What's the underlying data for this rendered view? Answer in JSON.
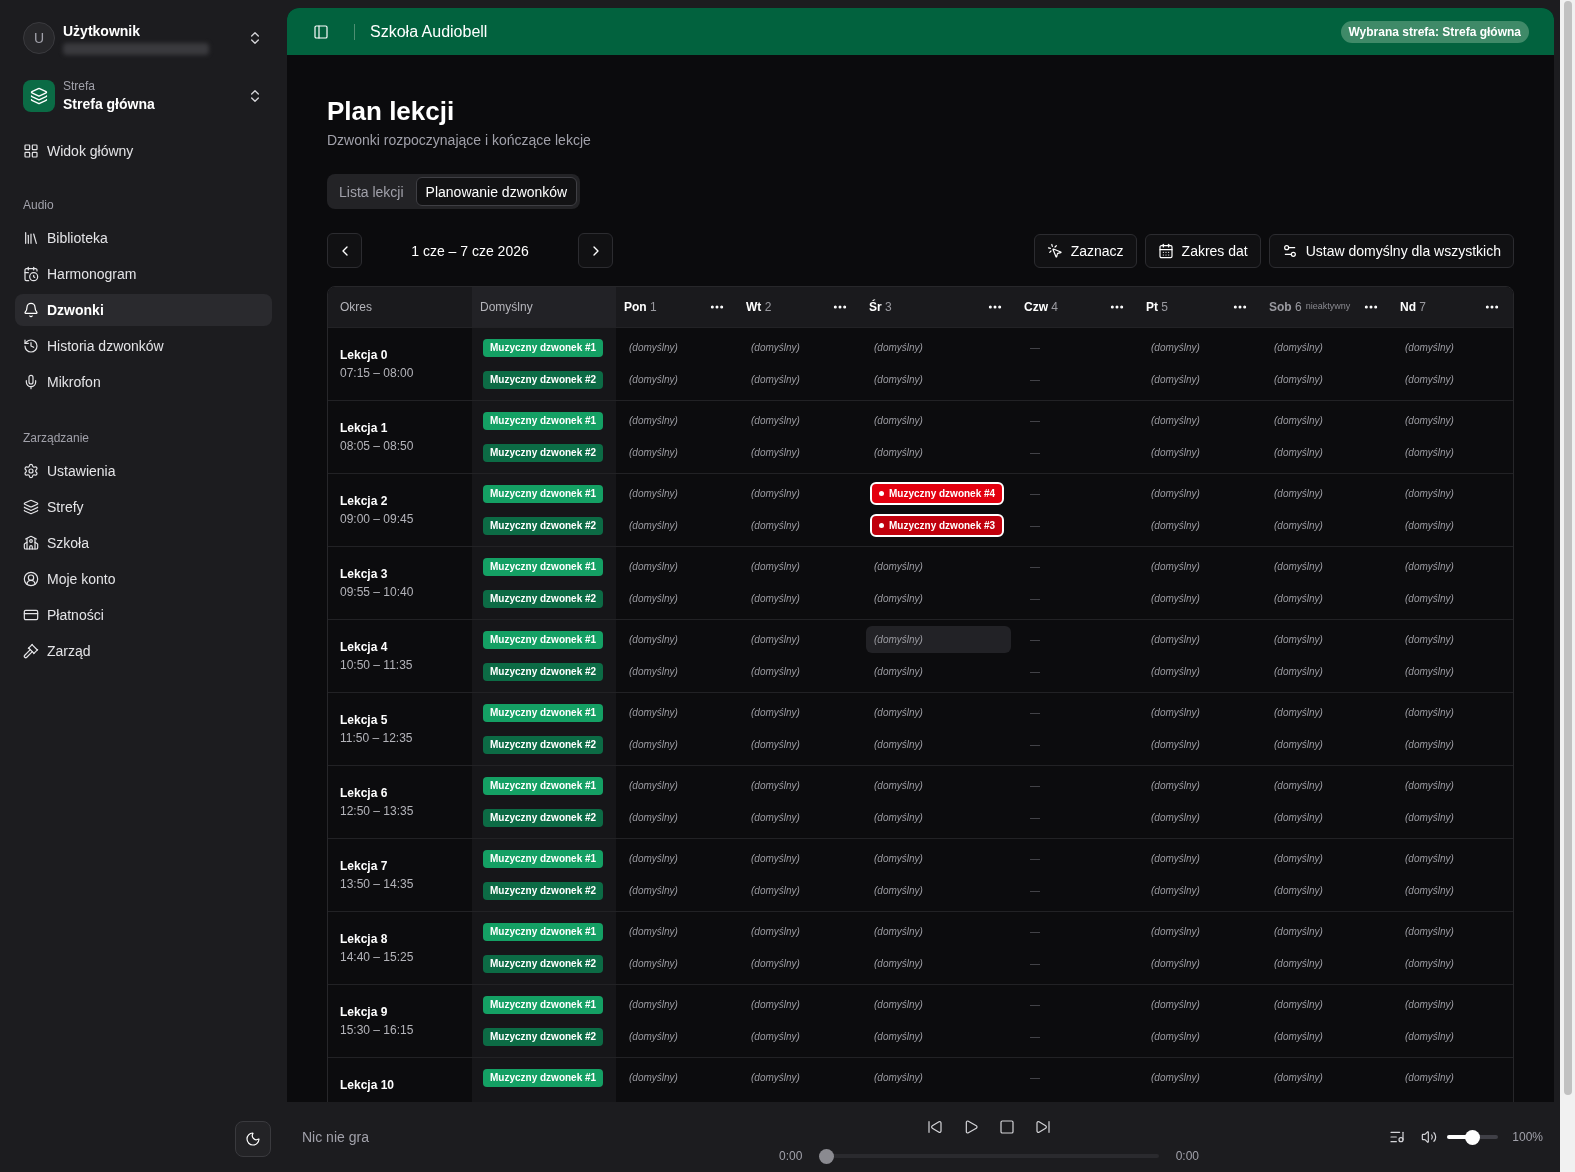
{
  "sidebar": {
    "user": {
      "avatar_letter": "U",
      "name": "Użytkownik"
    },
    "zone": {
      "label": "Strefa",
      "name": "Strefa główna"
    },
    "top_items": [
      {
        "label": "Widok główny",
        "selected": false
      }
    ],
    "sections": [
      {
        "title": "Audio",
        "items": [
          {
            "label": "Biblioteka",
            "selected": false
          },
          {
            "label": "Harmonogram",
            "selected": false
          },
          {
            "label": "Dzwonki",
            "selected": true
          },
          {
            "label": "Historia dzwonków",
            "selected": false
          },
          {
            "label": "Mikrofon",
            "selected": false
          }
        ]
      },
      {
        "title": "Zarządzanie",
        "items": [
          {
            "label": "Ustawienia",
            "selected": false
          },
          {
            "label": "Strefy",
            "selected": false
          },
          {
            "label": "Szkoła",
            "selected": false
          },
          {
            "label": "Moje konto",
            "selected": false
          },
          {
            "label": "Płatności",
            "selected": false
          },
          {
            "label": "Zarząd",
            "selected": false
          }
        ]
      }
    ]
  },
  "header": {
    "title": "Szkoła Audiobell",
    "zone_badge": "Wybrana strefa: Strefa główna"
  },
  "page": {
    "title": "Plan lekcji",
    "subtitle": "Dzwonki rozpoczynające i kończące lekcje"
  },
  "tabs": [
    {
      "label": "Lista lekcji",
      "selected": false
    },
    {
      "label": "Planowanie dzwonków",
      "selected": true
    }
  ],
  "date_range": "1 cze – 7 cze 2026",
  "actions": [
    {
      "label": "Zaznacz"
    },
    {
      "label": "Zakres dat"
    },
    {
      "label": "Ustaw domyślny dla wszystkich"
    }
  ],
  "table": {
    "columns": {
      "period": "Okres",
      "default": "Domyślny"
    },
    "days": [
      {
        "name": "Pon",
        "number": "1",
        "active": true
      },
      {
        "name": "Wt",
        "number": "2",
        "active": true
      },
      {
        "name": "Śr",
        "number": "3",
        "active": true
      },
      {
        "name": "Czw",
        "number": "4",
        "active": true
      },
      {
        "name": "Pt",
        "number": "5",
        "active": true
      },
      {
        "name": "Sob",
        "number": "6",
        "active": false,
        "note": "nieaktywny"
      },
      {
        "name": "Nd",
        "number": "7",
        "active": true
      }
    ],
    "rows": [
      {
        "name": "Lekcja 0",
        "time": "07:15 – 08:00",
        "slots": [
          {
            "default": {
              "label": "Muzyczny dzwonek #1",
              "color": "#14a064"
            },
            "cells": [
              {
                "kind": "default",
                "text": "(domyślny)",
                "highlighted": false
              },
              {
                "kind": "default",
                "text": "(domyślny)",
                "highlighted": false
              },
              {
                "kind": "default",
                "text": "(domyślny)",
                "highlighted": false
              },
              {
                "kind": "empty",
                "text": "—",
                "highlighted": false
              },
              {
                "kind": "default",
                "text": "(domyślny)",
                "highlighted": false
              },
              {
                "kind": "default",
                "text": "(domyślny)",
                "highlighted": false
              },
              {
                "kind": "default",
                "text": "(domyślny)",
                "highlighted": false
              }
            ]
          },
          {
            "default": {
              "label": "Muzyczny dzwonek #2",
              "color": "#0c6b45"
            },
            "cells": [
              {
                "kind": "default",
                "text": "(domyślny)",
                "highlighted": false
              },
              {
                "kind": "default",
                "text": "(domyślny)",
                "highlighted": false
              },
              {
                "kind": "default",
                "text": "(domyślny)",
                "highlighted": false
              },
              {
                "kind": "empty",
                "text": "—",
                "highlighted": false
              },
              {
                "kind": "default",
                "text": "(domyślny)",
                "highlighted": false
              },
              {
                "kind": "default",
                "text": "(domyślny)",
                "highlighted": false
              },
              {
                "kind": "default",
                "text": "(domyślny)",
                "highlighted": false
              }
            ]
          }
        ]
      },
      {
        "name": "Lekcja 1",
        "time": "08:05 – 08:50",
        "slots": [
          {
            "default": {
              "label": "Muzyczny dzwonek #1",
              "color": "#14a064"
            },
            "cells": [
              {
                "kind": "default",
                "text": "(domyślny)",
                "highlighted": false
              },
              {
                "kind": "default",
                "text": "(domyślny)",
                "highlighted": false
              },
              {
                "kind": "default",
                "text": "(domyślny)",
                "highlighted": false
              },
              {
                "kind": "empty",
                "text": "—",
                "highlighted": false
              },
              {
                "kind": "default",
                "text": "(domyślny)",
                "highlighted": false
              },
              {
                "kind": "default",
                "text": "(domyślny)",
                "highlighted": false
              },
              {
                "kind": "default",
                "text": "(domyślny)",
                "highlighted": false
              }
            ]
          },
          {
            "default": {
              "label": "Muzyczny dzwonek #2",
              "color": "#0c6b45"
            },
            "cells": [
              {
                "kind": "default",
                "text": "(domyślny)",
                "highlighted": false
              },
              {
                "kind": "default",
                "text": "(domyślny)",
                "highlighted": false
              },
              {
                "kind": "default",
                "text": "(domyślny)",
                "highlighted": false
              },
              {
                "kind": "empty",
                "text": "—",
                "highlighted": false
              },
              {
                "kind": "default",
                "text": "(domyślny)",
                "highlighted": false
              },
              {
                "kind": "default",
                "text": "(domyślny)",
                "highlighted": false
              },
              {
                "kind": "default",
                "text": "(domyślny)",
                "highlighted": false
              }
            ]
          }
        ]
      },
      {
        "name": "Lekcja 2",
        "time": "09:00 – 09:45",
        "slots": [
          {
            "default": {
              "label": "Muzyczny dzwonek #1",
              "color": "#14a064"
            },
            "cells": [
              {
                "kind": "default",
                "text": "(domyślny)",
                "highlighted": false
              },
              {
                "kind": "default",
                "text": "(domyślny)",
                "highlighted": false
              },
              {
                "kind": "override",
                "text": "Muzyczny dzwonek #4",
                "color": "#e3000f",
                "highlighted": false
              },
              {
                "kind": "empty",
                "text": "—",
                "highlighted": false
              },
              {
                "kind": "default",
                "text": "(domyślny)",
                "highlighted": false
              },
              {
                "kind": "default",
                "text": "(domyślny)",
                "highlighted": false
              },
              {
                "kind": "default",
                "text": "(domyślny)",
                "highlighted": false
              }
            ]
          },
          {
            "default": {
              "label": "Muzyczny dzwonek #2",
              "color": "#0c6b45"
            },
            "cells": [
              {
                "kind": "default",
                "text": "(domyślny)",
                "highlighted": false
              },
              {
                "kind": "default",
                "text": "(domyślny)",
                "highlighted": false
              },
              {
                "kind": "override",
                "text": "Muzyczny dzwonek #3",
                "color": "#c0000c",
                "highlighted": false
              },
              {
                "kind": "empty",
                "text": "—",
                "highlighted": false
              },
              {
                "kind": "default",
                "text": "(domyślny)",
                "highlighted": false
              },
              {
                "kind": "default",
                "text": "(domyślny)",
                "highlighted": false
              },
              {
                "kind": "default",
                "text": "(domyślny)",
                "highlighted": false
              }
            ]
          }
        ]
      },
      {
        "name": "Lekcja 3",
        "time": "09:55 – 10:40",
        "slots": [
          {
            "default": {
              "label": "Muzyczny dzwonek #1",
              "color": "#14a064"
            },
            "cells": [
              {
                "kind": "default",
                "text": "(domyślny)",
                "highlighted": false
              },
              {
                "kind": "default",
                "text": "(domyślny)",
                "highlighted": false
              },
              {
                "kind": "default",
                "text": "(domyślny)",
                "highlighted": false
              },
              {
                "kind": "empty",
                "text": "—",
                "highlighted": false
              },
              {
                "kind": "default",
                "text": "(domyślny)",
                "highlighted": false
              },
              {
                "kind": "default",
                "text": "(domyślny)",
                "highlighted": false
              },
              {
                "kind": "default",
                "text": "(domyślny)",
                "highlighted": false
              }
            ]
          },
          {
            "default": {
              "label": "Muzyczny dzwonek #2",
              "color": "#0c6b45"
            },
            "cells": [
              {
                "kind": "default",
                "text": "(domyślny)",
                "highlighted": false
              },
              {
                "kind": "default",
                "text": "(domyślny)",
                "highlighted": false
              },
              {
                "kind": "default",
                "text": "(domyślny)",
                "highlighted": false
              },
              {
                "kind": "empty",
                "text": "—",
                "highlighted": false
              },
              {
                "kind": "default",
                "text": "(domyślny)",
                "highlighted": false
              },
              {
                "kind": "default",
                "text": "(domyślny)",
                "highlighted": false
              },
              {
                "kind": "default",
                "text": "(domyślny)",
                "highlighted": false
              }
            ]
          }
        ]
      },
      {
        "name": "Lekcja 4",
        "time": "10:50 – 11:35",
        "slots": [
          {
            "default": {
              "label": "Muzyczny dzwonek #1",
              "color": "#14a064"
            },
            "cells": [
              {
                "kind": "default",
                "text": "(domyślny)",
                "highlighted": false
              },
              {
                "kind": "default",
                "text": "(domyślny)",
                "highlighted": false
              },
              {
                "kind": "default",
                "text": "(domyślny)",
                "highlighted": true
              },
              {
                "kind": "empty",
                "text": "—",
                "highlighted": false
              },
              {
                "kind": "default",
                "text": "(domyślny)",
                "highlighted": false
              },
              {
                "kind": "default",
                "text": "(domyślny)",
                "highlighted": false
              },
              {
                "kind": "default",
                "text": "(domyślny)",
                "highlighted": false
              }
            ]
          },
          {
            "default": {
              "label": "Muzyczny dzwonek #2",
              "color": "#0c6b45"
            },
            "cells": [
              {
                "kind": "default",
                "text": "(domyślny)",
                "highlighted": false
              },
              {
                "kind": "default",
                "text": "(domyślny)",
                "highlighted": false
              },
              {
                "kind": "default",
                "text": "(domyślny)",
                "highlighted": false
              },
              {
                "kind": "empty",
                "text": "—",
                "highlighted": false
              },
              {
                "kind": "default",
                "text": "(domyślny)",
                "highlighted": false
              },
              {
                "kind": "default",
                "text": "(domyślny)",
                "highlighted": false
              },
              {
                "kind": "default",
                "text": "(domyślny)",
                "highlighted": false
              }
            ]
          }
        ]
      },
      {
        "name": "Lekcja 5",
        "time": "11:50 – 12:35",
        "slots": [
          {
            "default": {
              "label": "Muzyczny dzwonek #1",
              "color": "#14a064"
            },
            "cells": [
              {
                "kind": "default",
                "text": "(domyślny)",
                "highlighted": false
              },
              {
                "kind": "default",
                "text": "(domyślny)",
                "highlighted": false
              },
              {
                "kind": "default",
                "text": "(domyślny)",
                "highlighted": false
              },
              {
                "kind": "empty",
                "text": "—",
                "highlighted": false
              },
              {
                "kind": "default",
                "text": "(domyślny)",
                "highlighted": false
              },
              {
                "kind": "default",
                "text": "(domyślny)",
                "highlighted": false
              },
              {
                "kind": "default",
                "text": "(domyślny)",
                "highlighted": false
              }
            ]
          },
          {
            "default": {
              "label": "Muzyczny dzwonek #2",
              "color": "#0c6b45"
            },
            "cells": [
              {
                "kind": "default",
                "text": "(domyślny)",
                "highlighted": false
              },
              {
                "kind": "default",
                "text": "(domyślny)",
                "highlighted": false
              },
              {
                "kind": "default",
                "text": "(domyślny)",
                "highlighted": false
              },
              {
                "kind": "empty",
                "text": "—",
                "highlighted": false
              },
              {
                "kind": "default",
                "text": "(domyślny)",
                "highlighted": false
              },
              {
                "kind": "default",
                "text": "(domyślny)",
                "highlighted": false
              },
              {
                "kind": "default",
                "text": "(domyślny)",
                "highlighted": false
              }
            ]
          }
        ]
      },
      {
        "name": "Lekcja 6",
        "time": "12:50 – 13:35",
        "slots": [
          {
            "default": {
              "label": "Muzyczny dzwonek #1",
              "color": "#14a064"
            },
            "cells": [
              {
                "kind": "default",
                "text": "(domyślny)",
                "highlighted": false
              },
              {
                "kind": "default",
                "text": "(domyślny)",
                "highlighted": false
              },
              {
                "kind": "default",
                "text": "(domyślny)",
                "highlighted": false
              },
              {
                "kind": "empty",
                "text": "—",
                "highlighted": false
              },
              {
                "kind": "default",
                "text": "(domyślny)",
                "highlighted": false
              },
              {
                "kind": "default",
                "text": "(domyślny)",
                "highlighted": false
              },
              {
                "kind": "default",
                "text": "(domyślny)",
                "highlighted": false
              }
            ]
          },
          {
            "default": {
              "label": "Muzyczny dzwonek #2",
              "color": "#0c6b45"
            },
            "cells": [
              {
                "kind": "default",
                "text": "(domyślny)",
                "highlighted": false
              },
              {
                "kind": "default",
                "text": "(domyślny)",
                "highlighted": false
              },
              {
                "kind": "default",
                "text": "(domyślny)",
                "highlighted": false
              },
              {
                "kind": "empty",
                "text": "—",
                "highlighted": false
              },
              {
                "kind": "default",
                "text": "(domyślny)",
                "highlighted": false
              },
              {
                "kind": "default",
                "text": "(domyślny)",
                "highlighted": false
              },
              {
                "kind": "default",
                "text": "(domyślny)",
                "highlighted": false
              }
            ]
          }
        ]
      },
      {
        "name": "Lekcja 7",
        "time": "13:50 – 14:35",
        "slots": [
          {
            "default": {
              "label": "Muzyczny dzwonek #1",
              "color": "#14a064"
            },
            "cells": [
              {
                "kind": "default",
                "text": "(domyślny)",
                "highlighted": false
              },
              {
                "kind": "default",
                "text": "(domyślny)",
                "highlighted": false
              },
              {
                "kind": "default",
                "text": "(domyślny)",
                "highlighted": false
              },
              {
                "kind": "empty",
                "text": "—",
                "highlighted": false
              },
              {
                "kind": "default",
                "text": "(domyślny)",
                "highlighted": false
              },
              {
                "kind": "default",
                "text": "(domyślny)",
                "highlighted": false
              },
              {
                "kind": "default",
                "text": "(domyślny)",
                "highlighted": false
              }
            ]
          },
          {
            "default": {
              "label": "Muzyczny dzwonek #2",
              "color": "#0c6b45"
            },
            "cells": [
              {
                "kind": "default",
                "text": "(domyślny)",
                "highlighted": false
              },
              {
                "kind": "default",
                "text": "(domyślny)",
                "highlighted": false
              },
              {
                "kind": "default",
                "text": "(domyślny)",
                "highlighted": false
              },
              {
                "kind": "empty",
                "text": "—",
                "highlighted": false
              },
              {
                "kind": "default",
                "text": "(domyślny)",
                "highlighted": false
              },
              {
                "kind": "default",
                "text": "(domyślny)",
                "highlighted": false
              },
              {
                "kind": "default",
                "text": "(domyślny)",
                "highlighted": false
              }
            ]
          }
        ]
      },
      {
        "name": "Lekcja 8",
        "time": "14:40 – 15:25",
        "slots": [
          {
            "default": {
              "label": "Muzyczny dzwonek #1",
              "color": "#14a064"
            },
            "cells": [
              {
                "kind": "default",
                "text": "(domyślny)",
                "highlighted": false
              },
              {
                "kind": "default",
                "text": "(domyślny)",
                "highlighted": false
              },
              {
                "kind": "default",
                "text": "(domyślny)",
                "highlighted": false
              },
              {
                "kind": "empty",
                "text": "—",
                "highlighted": false
              },
              {
                "kind": "default",
                "text": "(domyślny)",
                "highlighted": false
              },
              {
                "kind": "default",
                "text": "(domyślny)",
                "highlighted": false
              },
              {
                "kind": "default",
                "text": "(domyślny)",
                "highlighted": false
              }
            ]
          },
          {
            "default": {
              "label": "Muzyczny dzwonek #2",
              "color": "#0c6b45"
            },
            "cells": [
              {
                "kind": "default",
                "text": "(domyślny)",
                "highlighted": false
              },
              {
                "kind": "default",
                "text": "(domyślny)",
                "highlighted": false
              },
              {
                "kind": "default",
                "text": "(domyślny)",
                "highlighted": false
              },
              {
                "kind": "empty",
                "text": "—",
                "highlighted": false
              },
              {
                "kind": "default",
                "text": "(domyślny)",
                "highlighted": false
              },
              {
                "kind": "default",
                "text": "(domyślny)",
                "highlighted": false
              },
              {
                "kind": "default",
                "text": "(domyślny)",
                "highlighted": false
              }
            ]
          }
        ]
      },
      {
        "name": "Lekcja 9",
        "time": "15:30 – 16:15",
        "slots": [
          {
            "default": {
              "label": "Muzyczny dzwonek #1",
              "color": "#14a064"
            },
            "cells": [
              {
                "kind": "default",
                "text": "(domyślny)",
                "highlighted": false
              },
              {
                "kind": "default",
                "text": "(domyślny)",
                "highlighted": false
              },
              {
                "kind": "default",
                "text": "(domyślny)",
                "highlighted": false
              },
              {
                "kind": "empty",
                "text": "—",
                "highlighted": false
              },
              {
                "kind": "default",
                "text": "(domyślny)",
                "highlighted": false
              },
              {
                "kind": "default",
                "text": "(domyślny)",
                "highlighted": false
              },
              {
                "kind": "default",
                "text": "(domyślny)",
                "highlighted": false
              }
            ]
          },
          {
            "default": {
              "label": "Muzyczny dzwonek #2",
              "color": "#0c6b45"
            },
            "cells": [
              {
                "kind": "default",
                "text": "(domyślny)",
                "highlighted": false
              },
              {
                "kind": "default",
                "text": "(domyślny)",
                "highlighted": false
              },
              {
                "kind": "default",
                "text": "(domyślny)",
                "highlighted": false
              },
              {
                "kind": "empty",
                "text": "—",
                "highlighted": false
              },
              {
                "kind": "default",
                "text": "(domyślny)",
                "highlighted": false
              },
              {
                "kind": "default",
                "text": "(domyślny)",
                "highlighted": false
              },
              {
                "kind": "default",
                "text": "(domyślny)",
                "highlighted": false
              }
            ]
          }
        ]
      },
      {
        "name": "Lekcja 10",
        "slots": [
          {
            "default": {
              "label": "Muzyczny dzwonek #1",
              "color": "#14a064"
            },
            "cells": [
              {
                "kind": "default",
                "text": "(domyślny)",
                "highlighted": false
              },
              {
                "kind": "default",
                "text": "(domyślny)",
                "highlighted": false
              },
              {
                "kind": "default",
                "text": "(domyślny)",
                "highlighted": false
              },
              {
                "kind": "empty",
                "text": "—",
                "highlighted": false
              },
              {
                "kind": "default",
                "text": "(domyślny)",
                "highlighted": false
              },
              {
                "kind": "default",
                "text": "(domyślny)",
                "highlighted": false
              },
              {
                "kind": "default",
                "text": "(domyślny)",
                "highlighted": false
              }
            ]
          }
        ]
      }
    ]
  },
  "player": {
    "status": "Nic nie gra",
    "position": "0:00",
    "duration": "0:00",
    "progress": {
      "level": 0
    },
    "volume": {
      "level": 0.5,
      "reading": "100%"
    }
  }
}
